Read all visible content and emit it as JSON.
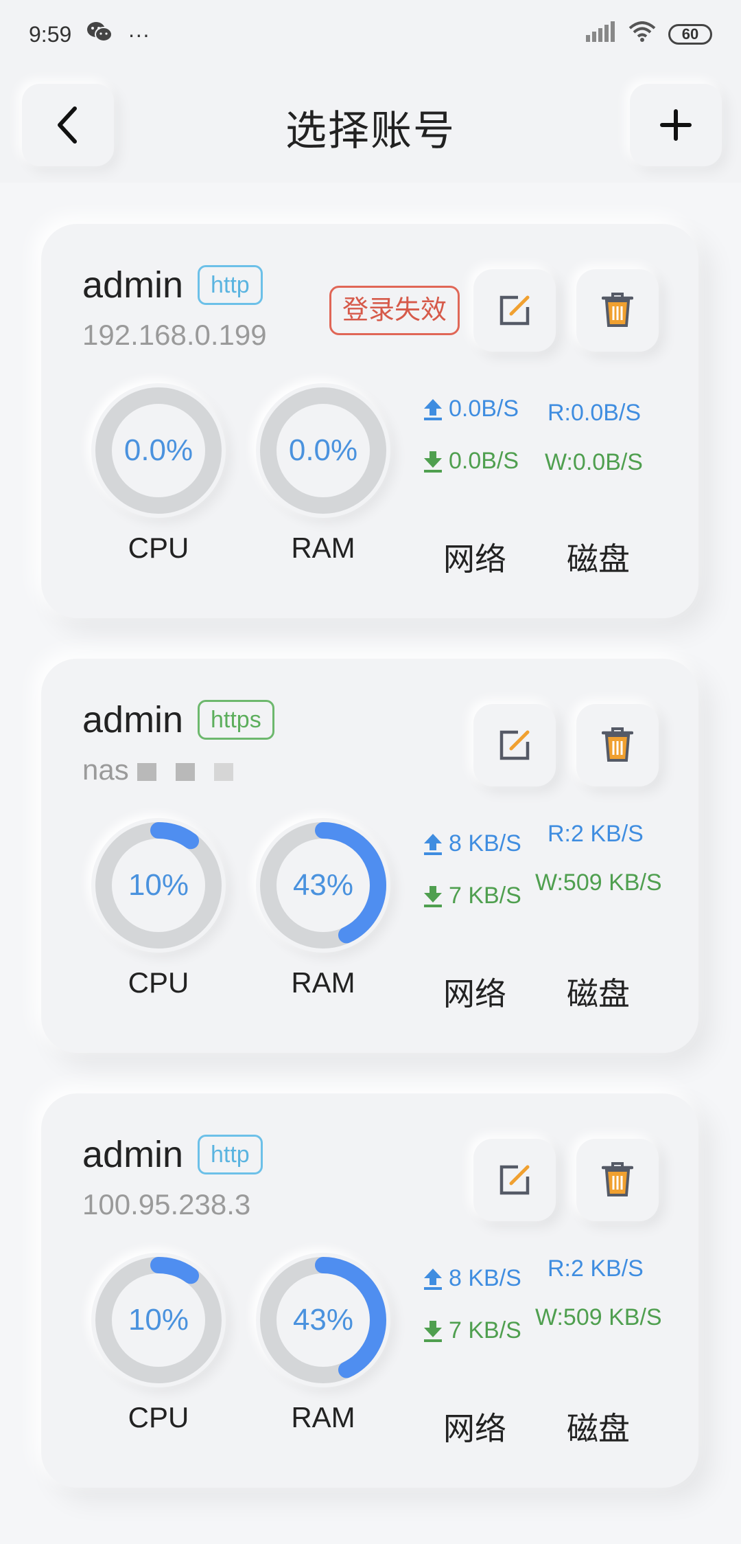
{
  "status_bar": {
    "time": "9:59",
    "dots": "···",
    "battery": "60"
  },
  "header": {
    "title": "选择账号"
  },
  "labels": {
    "cpu": "CPU",
    "ram": "RAM",
    "network": "网络",
    "disk": "磁盘"
  },
  "colors": {
    "accent_blue": "#4a92de",
    "ring_fill": "#4f8ef0",
    "ring_track": "#d4d6d8",
    "upload_blue": "#3f8de0",
    "download_green": "#4f9f4f",
    "error_red": "#d65a4a",
    "edit_orange": "#f0a030",
    "delete_orange": "#e8a030"
  },
  "accounts": [
    {
      "username": "admin",
      "protocol": "http",
      "host": "192.168.0.199",
      "status_badge": "登录失效",
      "cpu_percent": 0.0,
      "cpu_text": "0.0%",
      "ram_percent": 0.0,
      "ram_text": "0.0%",
      "net_up": "0.0B/S",
      "net_down": "0.0B/S",
      "disk_read": "R:0.0B/S",
      "disk_write": "W:0.0B/S"
    },
    {
      "username": "admin",
      "protocol": "https",
      "host": "nas",
      "cpu_percent": 10,
      "cpu_text": "10%",
      "ram_percent": 43,
      "ram_text": "43%",
      "net_up": "8 KB/S",
      "net_down": "7 KB/S",
      "disk_read": "R:2 KB/S",
      "disk_write": "W:509 KB/S"
    },
    {
      "username": "admin",
      "protocol": "http",
      "host": "100.95.238.3",
      "cpu_percent": 10,
      "cpu_text": "10%",
      "ram_percent": 43,
      "ram_text": "43%",
      "net_up": "8 KB/S",
      "net_down": "7 KB/S",
      "disk_read": "R:2 KB/S",
      "disk_write": "W:509 KB/S"
    }
  ]
}
